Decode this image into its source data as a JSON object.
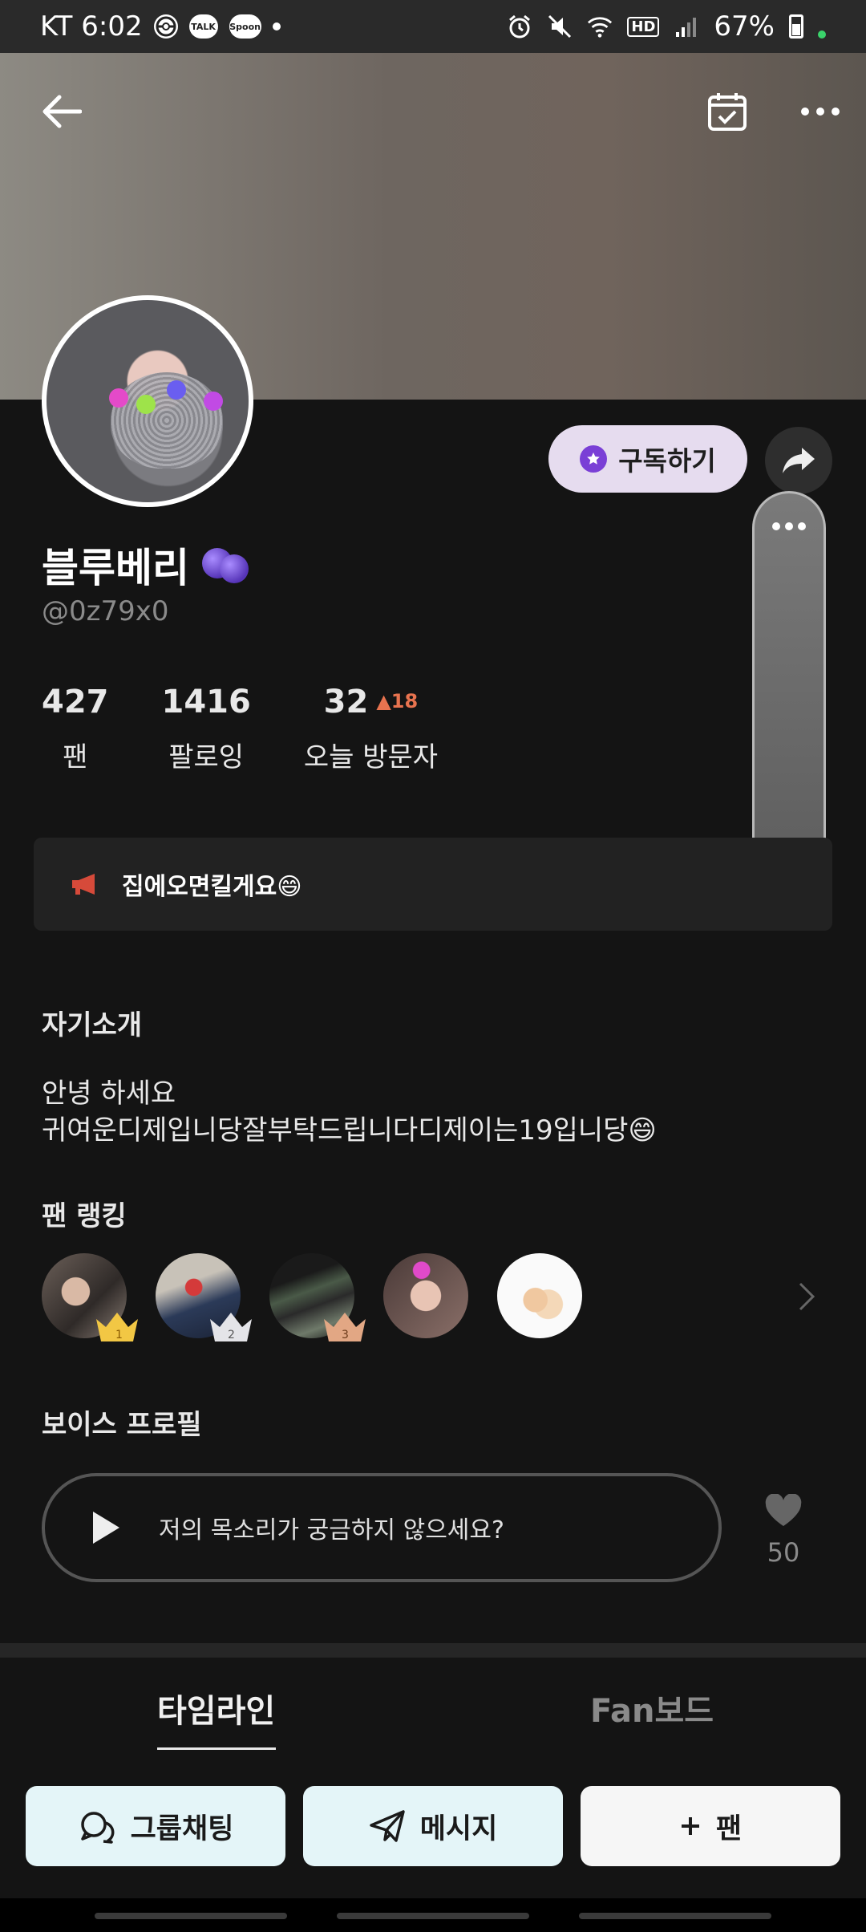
{
  "status_bar": {
    "carrier_time": "KT 6:02",
    "apps": [
      "TALK",
      "Spoon"
    ],
    "network": "HD",
    "battery": "67%"
  },
  "profile": {
    "subscribe_label": "구독하기",
    "name": "블루베리",
    "handle": "@0z79x0",
    "stats": [
      {
        "value": "427",
        "label": "팬"
      },
      {
        "value": "1416",
        "label": "팔로잉"
      },
      {
        "value": "32",
        "label": "오늘 방문자",
        "delta": "18"
      }
    ],
    "notice": "집에오면킬게요😄"
  },
  "about": {
    "title": "자기소개",
    "lines": [
      "안녕 하세요",
      "귀여운디제입니당잘부탁드립니다디제이는19입니당😄"
    ]
  },
  "fan_ranking": {
    "title": "팬 랭킹",
    "ranks": [
      "1",
      "2",
      "3"
    ]
  },
  "voice_profile": {
    "title": "보이스 프로필",
    "prompt": "저의 목소리가 궁금하지 않으세요?",
    "likes": "50"
  },
  "tabs": [
    "타임라인",
    "Fan보드"
  ],
  "actions": {
    "group_chat": "그룹채팅",
    "message": "메시지",
    "fan": "팬"
  },
  "colors": {
    "accent_purple": "#7a3fd6",
    "subscribe_bg": "#e6dcef",
    "action_bg": "#e4f5f8",
    "delta_up": "#e8734f"
  }
}
